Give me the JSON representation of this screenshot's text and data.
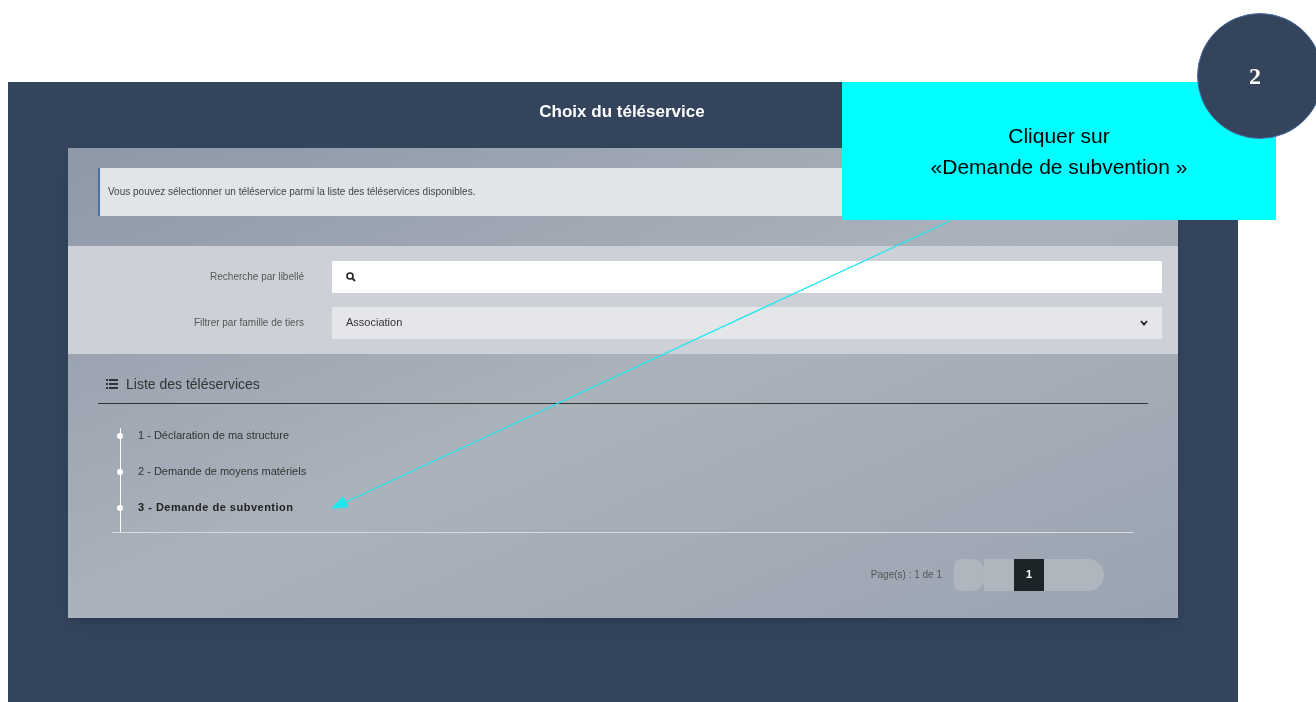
{
  "page": {
    "title": "Choix du téléservice",
    "info": "Vous pouvez sélectionner un téléservice parmi la liste des téléservices disponibles.",
    "search": {
      "label": "Recherche par libellé"
    },
    "filter": {
      "label": "Filtrer par famille de tiers",
      "value": "Association"
    },
    "list": {
      "title": "Liste des téléservices",
      "items": [
        {
          "label": "1 - Déclaration de ma structure",
          "highlighted": false
        },
        {
          "label": "2 - Demande de moyens matériels",
          "highlighted": false
        },
        {
          "label": "3 - Demande de subvention",
          "highlighted": true
        }
      ]
    },
    "pagination": {
      "summary": "Page(s) : 1 de 1",
      "pages": [
        {
          "label": "1",
          "selected": true
        }
      ]
    }
  },
  "annotation": {
    "step": "2",
    "callout_lines": [
      "Cliquer sur",
      "«Demande de subvention »"
    ]
  }
}
